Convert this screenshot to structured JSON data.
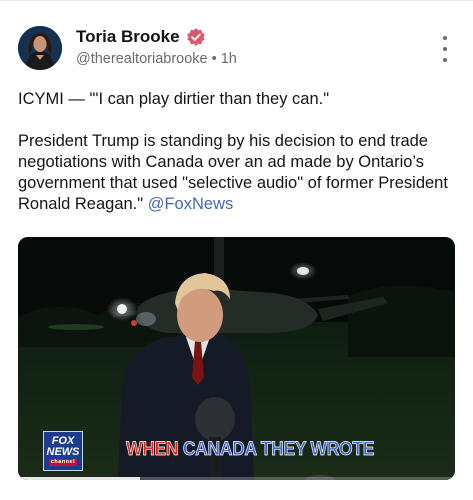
{
  "post": {
    "author_name": "Toria Brooke",
    "handle": "@therealtoriabrooke",
    "separator": "•",
    "time": "1h",
    "text_line1": "ICYMI — \"'I can play dirtier than they can.\"",
    "text_body": "President Trump is standing by his decision to end trade negotiations with Canada over an ad made by Ontario’s government that used \"selective audio\" of former President Ronald Reagan.\"",
    "mention": "@FoxNews"
  },
  "icons": {
    "verified": "verified-badge-icon",
    "menu": "more-vertical-icon"
  },
  "media": {
    "caption_word1": "WHEN",
    "caption_rest": "CANADA THEY WROTE",
    "logo_line1": "FOX",
    "logo_line2": "NEWS",
    "logo_line3": "channel",
    "progress_fraction": 0.28
  },
  "colors": {
    "verified_badge": "#e0566e",
    "link": "#4469b8",
    "caption_red": "#e0231c",
    "caption_blue": "#3f66c9"
  }
}
